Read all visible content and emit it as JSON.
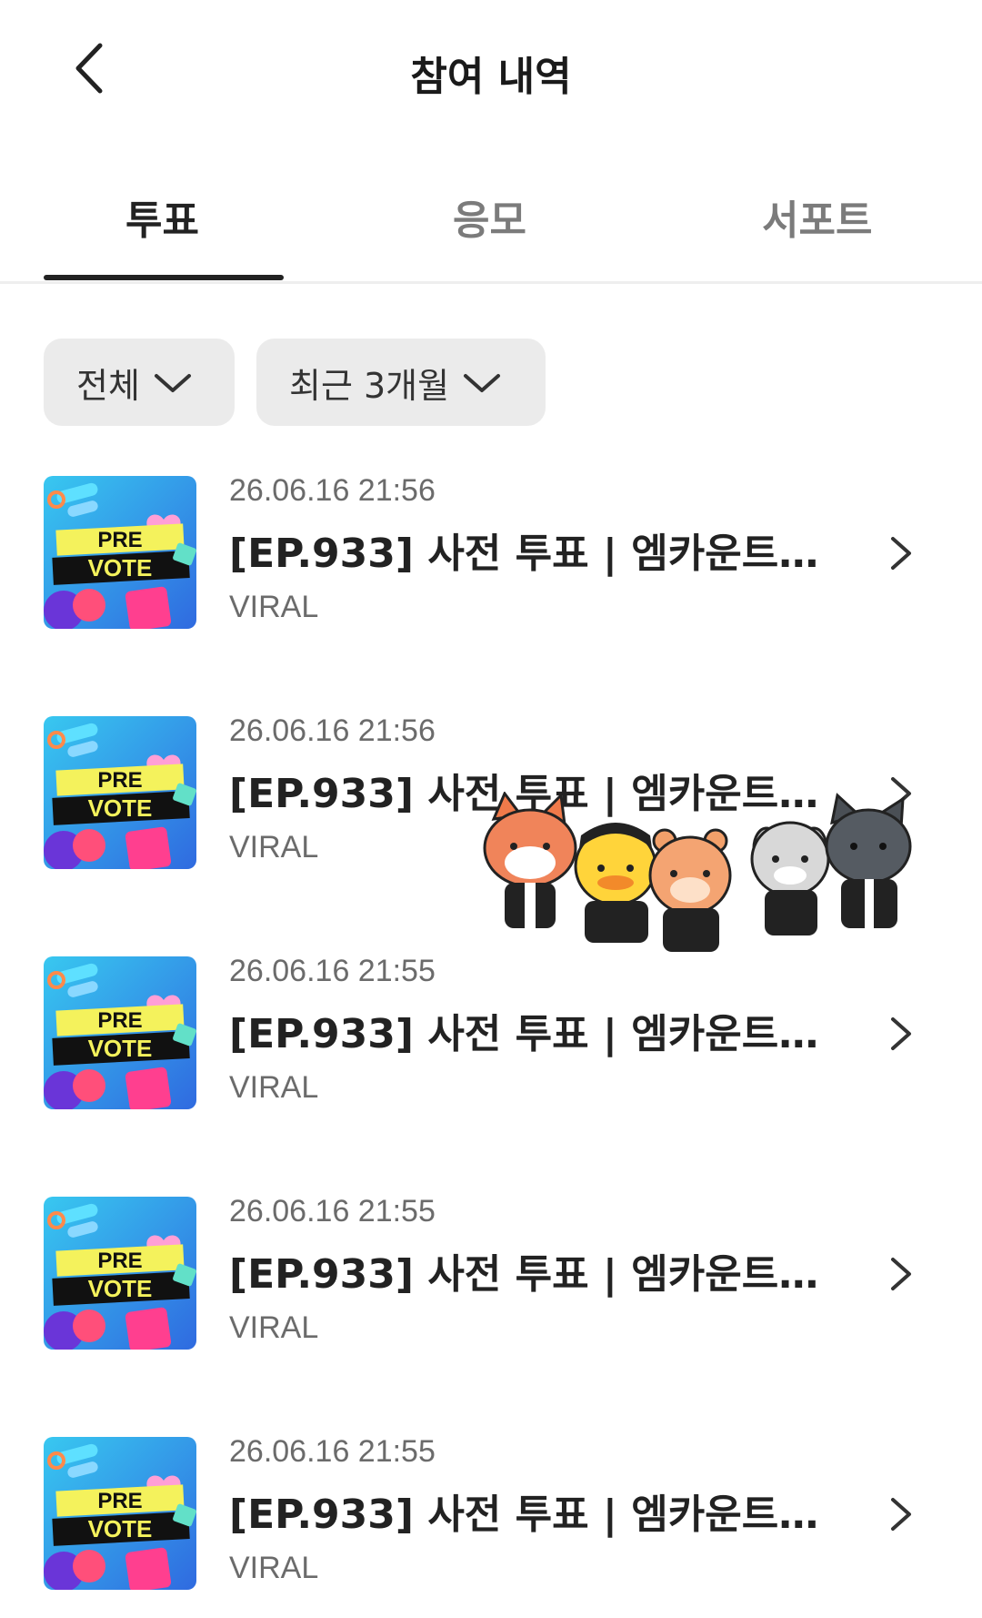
{
  "header": {
    "title": "참여 내역",
    "back_icon": "chevron-left-icon"
  },
  "tabs": [
    {
      "label": "투표",
      "active": true
    },
    {
      "label": "응모",
      "active": false
    },
    {
      "label": "서포트",
      "active": false
    }
  ],
  "filters": [
    {
      "label": "전체",
      "icon": "chevron-down-icon"
    },
    {
      "label": "최근 3개월",
      "icon": "chevron-down-icon"
    }
  ],
  "thumbnail": {
    "line1": "PRE",
    "line2": "VOTE"
  },
  "items": [
    {
      "date": "26.06.16 21:56",
      "title": "[EP.933] 사전 투표 | 엠카운트다...",
      "source": "VIRAL"
    },
    {
      "date": "26.06.16 21:56",
      "title": "[EP.933] 사전 투표 | 엠카운트다...",
      "source": "VIRAL"
    },
    {
      "date": "26.06.16 21:55",
      "title": "[EP.933] 사전 투표 | 엠카운트다...",
      "source": "VIRAL"
    },
    {
      "date": "26.06.16 21:55",
      "title": "[EP.933] 사전 투표 | 엠카운트다...",
      "source": "VIRAL"
    },
    {
      "date": "26.06.16 21:55",
      "title": "[EP.933] 사전 투표 | 엠카운트다...",
      "source": "VIRAL"
    }
  ],
  "colors": {
    "accent": "#222222",
    "muted": "#7b7b7b",
    "chip_bg": "#ebebeb"
  }
}
